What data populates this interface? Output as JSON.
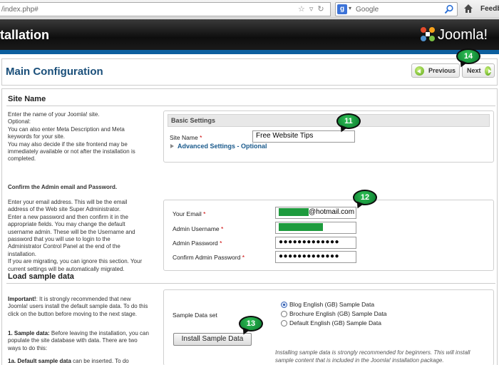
{
  "browser": {
    "url": "/index.php#",
    "search_placeholder": "Google",
    "feedback": "Feedb"
  },
  "header": {
    "title": "tallation",
    "logo_text": "Joomla!"
  },
  "page": {
    "title": "Main Configuration",
    "previous_label": "Previous",
    "next_label": "Next"
  },
  "site_name": {
    "heading": "Site Name",
    "help_lines": [
      "Enter the name of your Joomla! site.",
      "Optional:",
      "You can also enter Meta Description and Meta",
      "keywords for your site.",
      "You may also decide if the site frontend may be",
      "immediately available or not after the installation is",
      "completed."
    ],
    "box_title": "Basic Settings",
    "field_label": "Site Name",
    "field_value": "Free Website Tips",
    "advanced_label": "Advanced Settings - Optional"
  },
  "admin": {
    "heading": "Confirm the Admin email and Password.",
    "help_lines": [
      "Enter your email address. This will be the email",
      "address of the Web site Super Administrator.",
      "Enter a new password and then confirm it in the",
      "appropriate fields. You may change the default",
      "username admin. These will be the Username and",
      "password that you will use to login to the",
      "Administrator Control Panel at the end of the",
      "installation.",
      "If you are migrating, you can ignore this section. Your",
      "current settings will be automatically migrated."
    ],
    "email_label": "Your Email",
    "email_suffix": "@hotmail.com",
    "username_label": "Admin Username",
    "password_label": "Admin Password",
    "password_mask": "●●●●●●●●●●●●●",
    "confirm_label": "Confirm Admin Password",
    "confirm_mask": "●●●●●●●●●●●●●"
  },
  "sample": {
    "heading": "Load sample data",
    "help_p1_bold": "Important!",
    "help_p1": ": It is strongly recommended that new Joomla! users install the default sample data. To do this click on the button before moving to the next stage.",
    "help_p2_bold": "1. Sample data:",
    "help_p2": " Before leaving the installation, you can populate the site database with data. There are two ways to do this:",
    "help_p3_bold": "1a. Default sample data",
    "help_p3": " can be inserted. To do",
    "set_label": "Sample Data set",
    "options": [
      "Blog English (GB) Sample Data",
      "Brochure English (GB) Sample Data",
      "Default English (GB) Sample Data"
    ],
    "selected_option": "Blog English (GB) Sample Data",
    "install_button": "Install Sample Data",
    "note": "Installing sample data is strongly recommended for beginners. This will install sample content that is included in the Joomla! installation package."
  },
  "markers": {
    "m11": "11",
    "m12": "12",
    "m13": "13",
    "m14": "14"
  },
  "colors": {
    "header_bg": "#111111",
    "accent_blue": "#0b5e9e",
    "title_blue": "#1a4f7a",
    "marker_green": "#1ca24a",
    "redaction_green": "#1e9b3e"
  }
}
